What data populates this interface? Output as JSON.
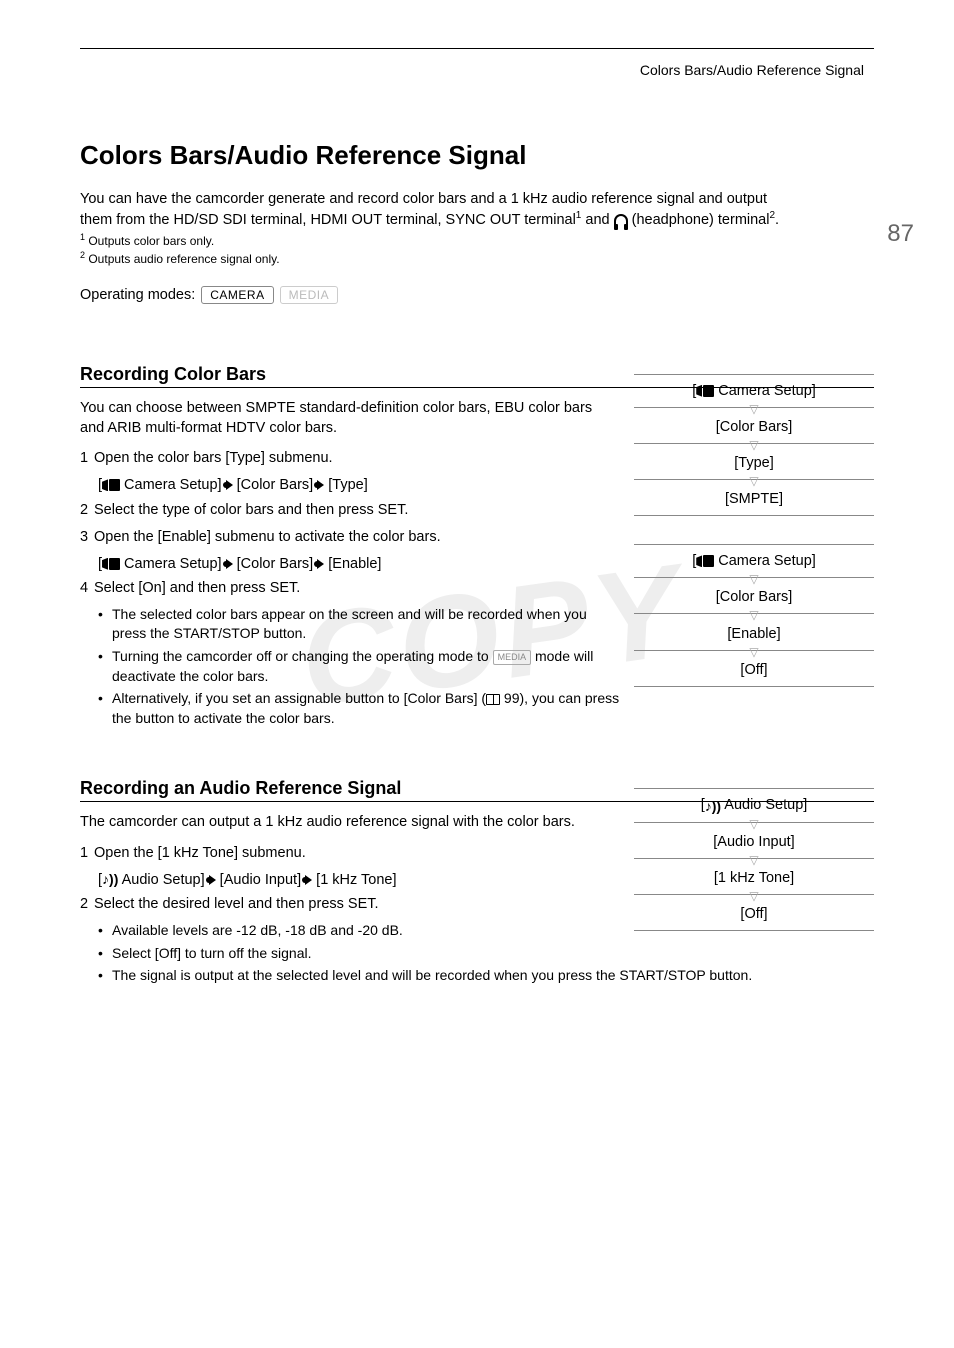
{
  "header_title": "Colors Bars/Audio Reference Signal",
  "page_number": "87",
  "main_title": "Colors Bars/Audio Reference Signal",
  "intro_line1": "You can have the camcorder generate and record color bars and a 1 kHz audio reference signal and output",
  "intro_line2_a": "them from the HD/SD SDI terminal, HDMI OUT terminal, SYNC OUT terminal",
  "intro_line2_b": " and ",
  "intro_line2_c": " (headphone) terminal",
  "footnote1": " Outputs color bars only.",
  "footnote2": " Outputs audio reference signal only.",
  "op_modes_label": "Operating modes:",
  "mode_camera": "CAMERA",
  "mode_media": "MEDIA",
  "section1": {
    "title": "Recording Color Bars",
    "body": "You can choose between SMPTE standard-definition color bars, EBU color bars and ARIB multi-format HDTV color bars.",
    "step1": "Open the color bars [Type] submenu.",
    "step1_path_a": " Camera Setup] ",
    "step1_path_b": " [Color Bars] ",
    "step1_path_c": " [Type]",
    "step2": "Select the type of color bars and then press SET.",
    "step3": "Open the [Enable] submenu to activate the color bars.",
    "step3_path_a": " Camera Setup] ",
    "step3_path_b": " [Color Bars] ",
    "step3_path_c": " [Enable]",
    "step4": "Select [On] and then press SET.",
    "bullet1": "The selected color bars appear on the screen and will be recorded when you press the START/STOP button.",
    "bullet2a": "Turning the camcorder off or changing the operating mode to ",
    "bullet2b": " mode will deactivate the color bars.",
    "bullet3a": "Alternatively, if you set an assignable button to [Color Bars] (",
    "bullet3b": " 99), you can press the button to activate the color bars."
  },
  "menu1": {
    "item1": " Camera Setup]",
    "item2": "[Color Bars]",
    "item3": "[Type]",
    "item4": "[SMPTE]"
  },
  "menu2": {
    "item1": " Camera Setup]",
    "item2": "[Color Bars]",
    "item3": "[Enable]",
    "item4": "[Off]"
  },
  "section2": {
    "title": "Recording an Audio Reference Signal",
    "body": "The camcorder can output a 1 kHz audio reference signal with the color bars.",
    "step1": "Open the [1 kHz Tone] submenu.",
    "step1_path_a": " Audio Setup] ",
    "step1_path_b": " [Audio Input] ",
    "step1_path_c": " [1 kHz Tone]",
    "step2": "Select the desired level and then press SET.",
    "bullet1": "Available levels are -12 dB, -18 dB and -20 dB.",
    "bullet2": "Select [Off] to turn off the signal.",
    "bullet3": "The signal is output at the selected level and will be recorded when you press the START/STOP button."
  },
  "menu3": {
    "item1": " Audio Setup]",
    "item2": "[Audio Input]",
    "item3": "[1 kHz Tone]",
    "item4": "[Off]"
  },
  "watermark": "COPY",
  "media_badge": "MEDIA"
}
